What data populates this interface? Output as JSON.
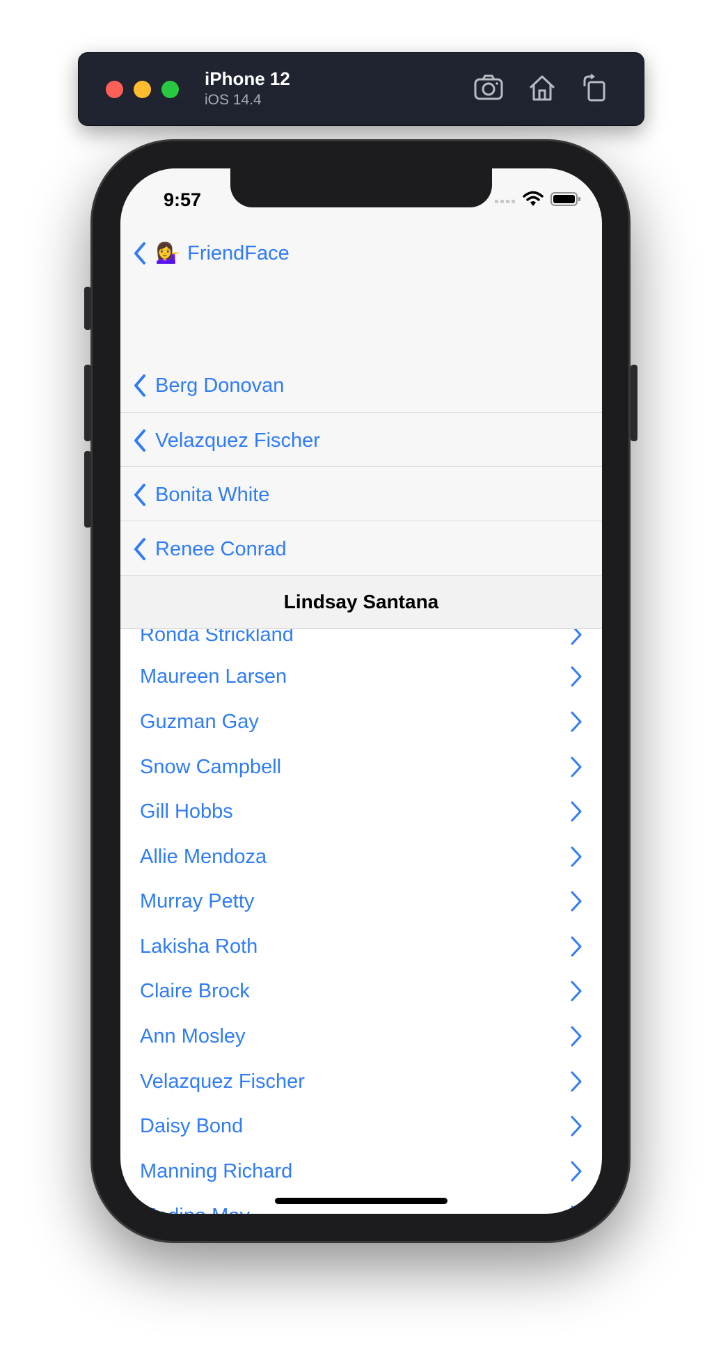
{
  "simulator": {
    "device_name": "iPhone 12",
    "os_version": "iOS 14.4",
    "icons": [
      "screenshot-icon",
      "home-icon",
      "rotate-icon"
    ]
  },
  "status_bar": {
    "time": "9:57",
    "icons": [
      "signal-icon",
      "wifi-icon",
      "battery-icon"
    ]
  },
  "navigation": {
    "root_back": {
      "emoji": "💁‍♀️",
      "label": "FriendFace"
    },
    "back_stack": [
      {
        "label": "Berg Donovan"
      },
      {
        "label": "Velazquez Fischer"
      },
      {
        "label": "Bonita White"
      },
      {
        "label": "Renee Conrad"
      }
    ],
    "title": "Lindsay Santana"
  },
  "friends_list": [
    {
      "name": "Ronda Strickland"
    },
    {
      "name": "Maureen Larsen"
    },
    {
      "name": "Guzman Gay"
    },
    {
      "name": "Snow Campbell"
    },
    {
      "name": "Gill Hobbs"
    },
    {
      "name": "Allie Mendoza"
    },
    {
      "name": "Murray Petty"
    },
    {
      "name": "Lakisha Roth"
    },
    {
      "name": "Claire Brock"
    },
    {
      "name": "Ann Mosley"
    },
    {
      "name": "Velazquez Fischer"
    },
    {
      "name": "Daisy Bond"
    },
    {
      "name": "Manning Richard"
    },
    {
      "name": "Medina May"
    }
  ],
  "colors": {
    "accent": "#2f7cf6",
    "nav_background": "#f7f7f8",
    "toolbar_background": "#1f2430"
  }
}
